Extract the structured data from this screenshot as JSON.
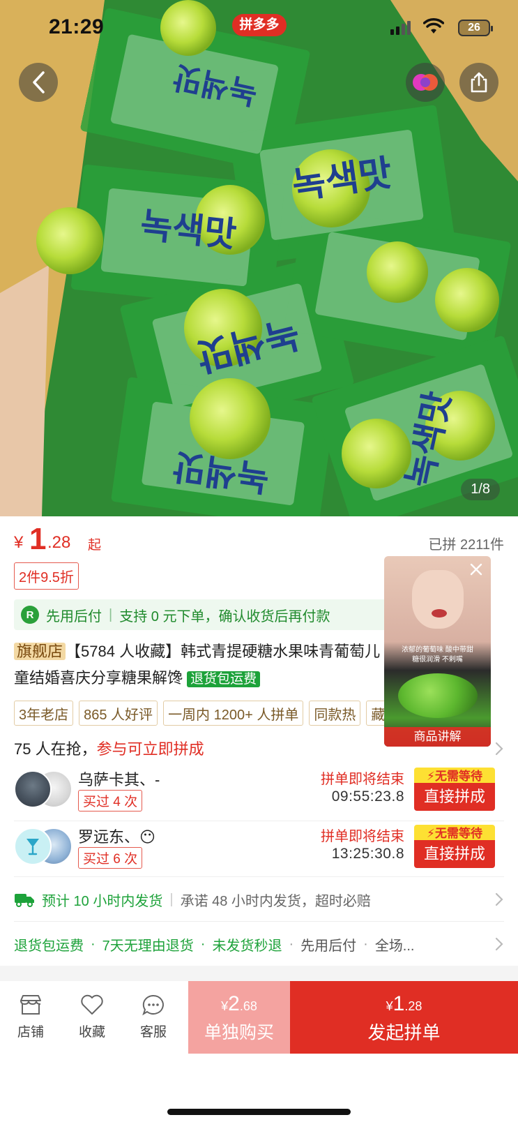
{
  "status_bar": {
    "time": "21:29",
    "app_badge": "拼多多",
    "battery": "26"
  },
  "gallery": {
    "counter": "1/8",
    "wrapper_text": "녹색맛"
  },
  "price": {
    "symbol": "¥",
    "integer": "1",
    "decimal": ".28",
    "suffix": "起",
    "sold": "已拼 2211件"
  },
  "discount_tag": "2件9.5折",
  "pay_later": {
    "badge": "R",
    "title": "先用后付",
    "text": "支持 0 元下单，确认收货后再付款"
  },
  "title": {
    "flag": "旗舰店",
    "text": "【5784 人收藏】韩式青提硬糖水果味青葡萄儿童结婚喜庆分享糖果解馋",
    "tag": "退货包运费"
  },
  "tags": [
    "3年老店",
    "865 人好评",
    "一周内 1200+ 人拼单",
    "同款热",
    "藏"
  ],
  "video": {
    "caption_line1": "浓郁的葡萄味  酸中带甜",
    "caption_line2": "糖很润滑  不剌嘴",
    "label": "商品讲解"
  },
  "grab": {
    "count_text": "75 人在抢，",
    "cta_text": "参与可立即拼成"
  },
  "groups": [
    {
      "name": "乌萨卡其、-",
      "bought": "买过 4 次",
      "ending": "拼单即将结束",
      "timer": "09:55:23.8",
      "no_wait": "无需等待",
      "join": "直接拼成",
      "emoji": ""
    },
    {
      "name": "罗远东、",
      "bought": "买过 6 次",
      "ending": "拼单即将结束",
      "timer": "13:25:30.8",
      "no_wait": "无需等待",
      "join": "直接拼成",
      "emoji": "😶"
    }
  ],
  "delivery": {
    "green": "预计 10 小时内发货",
    "grey": "承诺 48 小时内发货，超时必赔"
  },
  "services": [
    "退货包运费",
    "7天无理由退货",
    "未发货秒退",
    "先用后付",
    "全场..."
  ],
  "bottom": {
    "store": "店铺",
    "favorite": "收藏",
    "service": "客服",
    "single_symbol": "¥",
    "single_int": "2",
    "single_dec": ".68",
    "single_label": "单独购买",
    "group_symbol": "¥",
    "group_int": "1",
    "group_dec": ".28",
    "group_label": "发起拼单"
  },
  "colors": {
    "brand_red": "#e02e24",
    "green": "#1da23a",
    "pay_bg": "#eef8ef"
  }
}
